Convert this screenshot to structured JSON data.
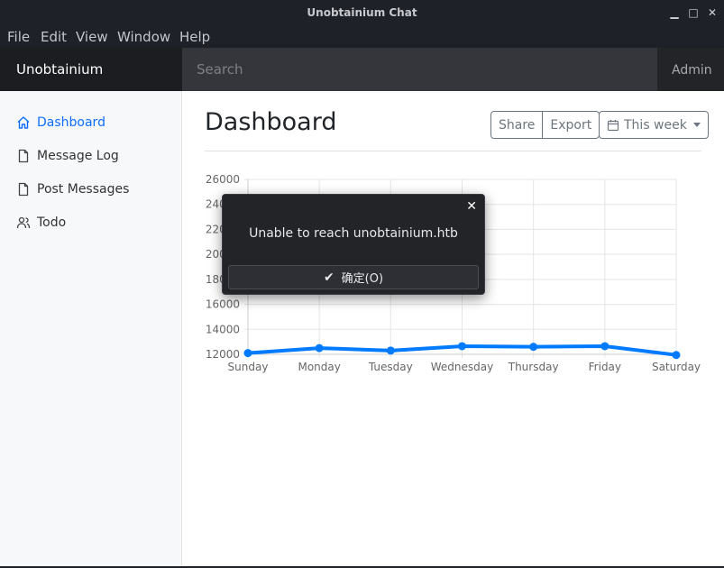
{
  "window": {
    "title": "Unobtainium Chat",
    "minimize_glyph": "▁",
    "maximize_glyph": "□",
    "close_glyph": "✕"
  },
  "menu": [
    "File",
    "Edit",
    "View",
    "Window",
    "Help"
  ],
  "header": {
    "brand": "Unobtainium",
    "search_placeholder": "Search",
    "user": "Admin"
  },
  "sidebar": {
    "items": [
      {
        "label": "Dashboard",
        "icon": "home-icon",
        "active": true
      },
      {
        "label": "Message Log",
        "icon": "file-icon",
        "active": false
      },
      {
        "label": "Post Messages",
        "icon": "file-icon",
        "active": false
      },
      {
        "label": "Todo",
        "icon": "users-icon",
        "active": false
      }
    ]
  },
  "main": {
    "title": "Dashboard",
    "share_label": "Share",
    "export_label": "Export",
    "period_label": "This week"
  },
  "chart_data": {
    "type": "line",
    "categories": [
      "Sunday",
      "Monday",
      "Tuesday",
      "Wednesday",
      "Thursday",
      "Friday",
      "Saturday"
    ],
    "values": [
      12100,
      12500,
      12300,
      12650,
      12600,
      12650,
      11950
    ],
    "y_ticks": [
      12000,
      14000,
      16000,
      18000,
      20000,
      22000,
      24000,
      26000
    ],
    "ylim": [
      12000,
      26000
    ],
    "grid": true,
    "color": "#007bff"
  },
  "dialog": {
    "message": "Unable to reach unobtainium.htb",
    "ok_label": "确定(O)",
    "close_glyph": "✕"
  }
}
